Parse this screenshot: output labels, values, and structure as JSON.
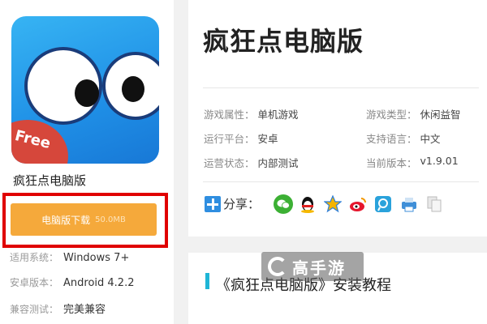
{
  "game": {
    "name": "疯狂点电脑版",
    "title": "疯狂点电脑版",
    "icon": "app-icon",
    "free_label": "Free"
  },
  "download": {
    "label": "电脑版下载",
    "size": "50.0MB",
    "color": "#f5a93b",
    "highlight_color": "#e00000"
  },
  "system": [
    {
      "key": "适用系统：",
      "value": "Windows 7+"
    },
    {
      "key": "安卓版本：",
      "value": "Android 4.2.2"
    },
    {
      "key": "兼容测试：",
      "value": "完美兼容"
    }
  ],
  "info": {
    "attribute": {
      "key": "游戏属性：",
      "value": "单机游戏"
    },
    "type": {
      "key": "游戏类型：",
      "value": "休闲益智"
    },
    "platform": {
      "key": "运行平台：",
      "value": "安卓"
    },
    "language": {
      "key": "支持语言：",
      "value": "中文"
    },
    "status": {
      "key": "运营状态：",
      "value": "内部测试"
    },
    "version": {
      "key": "当前版本：",
      "value": "v1.9.01"
    }
  },
  "share": {
    "label": "分享：",
    "icons": [
      "wechat-icon",
      "qq-icon",
      "qzone-icon",
      "weibo-icon",
      "tencent-weibo-icon",
      "print-icon",
      "copy-icon"
    ]
  },
  "tutorial": {
    "title": "《疯狂点电脑版》安装教程",
    "accent": "#1fb5d6"
  },
  "watermark": {
    "text": "高手游"
  }
}
